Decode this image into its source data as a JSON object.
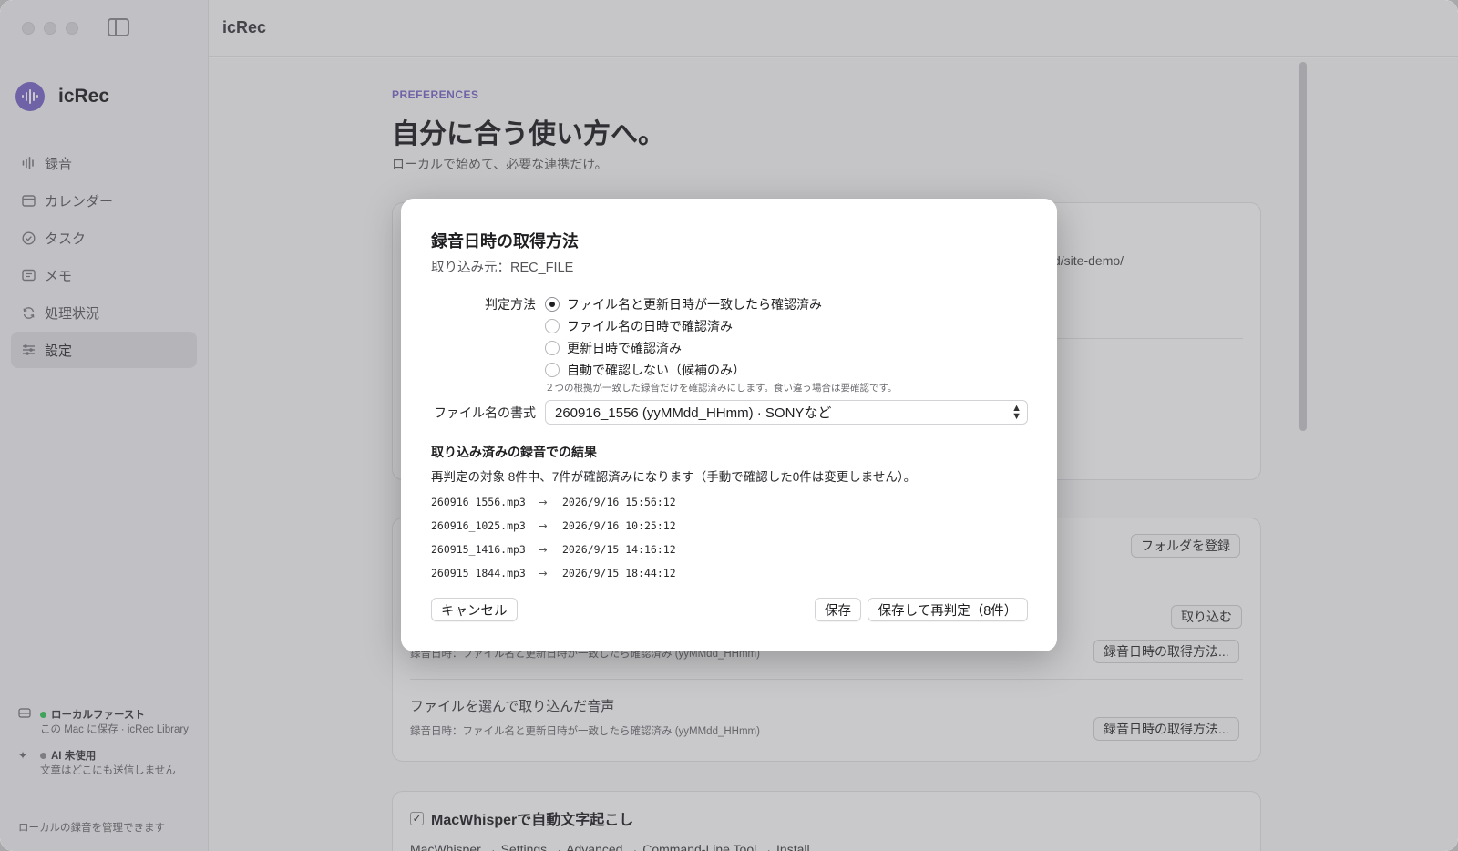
{
  "app": {
    "name": "icRec",
    "window_title": "icRec"
  },
  "sidebar": {
    "items": [
      {
        "label": "録音",
        "icon": "waveform-icon"
      },
      {
        "label": "カレンダー",
        "icon": "calendar-icon"
      },
      {
        "label": "タスク",
        "icon": "checkmark-circle-icon"
      },
      {
        "label": "メモ",
        "icon": "note-icon"
      },
      {
        "label": "処理状況",
        "icon": "refresh-icon"
      },
      {
        "label": "設定",
        "icon": "sliders-icon",
        "active": true
      }
    ],
    "status": {
      "local_title": "ローカルファースト",
      "local_sub": "この Mac に保存 · icRec Library",
      "ai_title": "AI 未使用",
      "ai_sub": "文章はどこにも送信しません"
    },
    "footer": "ローカルの録音を管理できます",
    "colors": {
      "local_dot": "#34c759",
      "ai_dot": "#8e8e93",
      "accent": "#7b66c9"
    }
  },
  "preferences": {
    "kicker": "PREFERENCES",
    "title": "自分に合う使い方へ。",
    "subtitle": "ローカルで始めて、必要な連携だけ。",
    "partial_path": "d/site-demo/",
    "register_folder_button": "フォルダを登録",
    "import_button": "取り込む",
    "method_button_1": "録音日時の取得方法...",
    "method_button_2": "録音日時の取得方法...",
    "partial_row_text": "録音日時：ファイル名と更新日時が一致したら確認済み (yyMMdd_HHmm)",
    "file_import_label": "ファイルを選んで取り込んだ音声",
    "file_import_sub": "録音日時：ファイル名と更新日時が一致したら確認済み (yyMMdd_HHmm)",
    "macwhisper_label": "MacWhisperで自動文字起こし",
    "macwhisper_checked": true,
    "macwhisper_path": "MacWhisper → Settings → Advanced → Command-Line Tool → Install"
  },
  "dialog": {
    "title": "録音日時の取得方法",
    "source": "取り込み元：REC_FILE",
    "method_label": "判定方法",
    "options": [
      {
        "label": "ファイル名と更新日時が一致したら確認済み",
        "selected": true
      },
      {
        "label": "ファイル名の日時で確認済み",
        "selected": false
      },
      {
        "label": "更新日時で確認済み",
        "selected": false
      },
      {
        "label": "自動で確認しない（候補のみ）",
        "selected": false
      }
    ],
    "hint": "２つの根拠が一致した録音だけを確認済みにします。食い違う場合は要確認です。",
    "format_label": "ファイル名の書式",
    "format_value": "260916_1556 (yyMMdd_HHmm) · SONYなど",
    "result_heading": "取り込み済みの録音での結果",
    "result_summary": "再判定の対象 8件中、7件が確認済みになります（手動で確認した0件は変更しません）。",
    "results": [
      {
        "file": "260916_1556.mp3",
        "date": "2026/9/16 15:56:12"
      },
      {
        "file": "260916_1025.mp3",
        "date": "2026/9/16 10:25:12"
      },
      {
        "file": "260915_1416.mp3",
        "date": "2026/9/15 14:16:12"
      },
      {
        "file": "260915_1844.mp3",
        "date": "2026/9/15 18:44:12"
      }
    ],
    "arrow": "→",
    "cancel": "キャンセル",
    "save": "保存",
    "save_rejudge": "保存して再判定（8件）"
  }
}
